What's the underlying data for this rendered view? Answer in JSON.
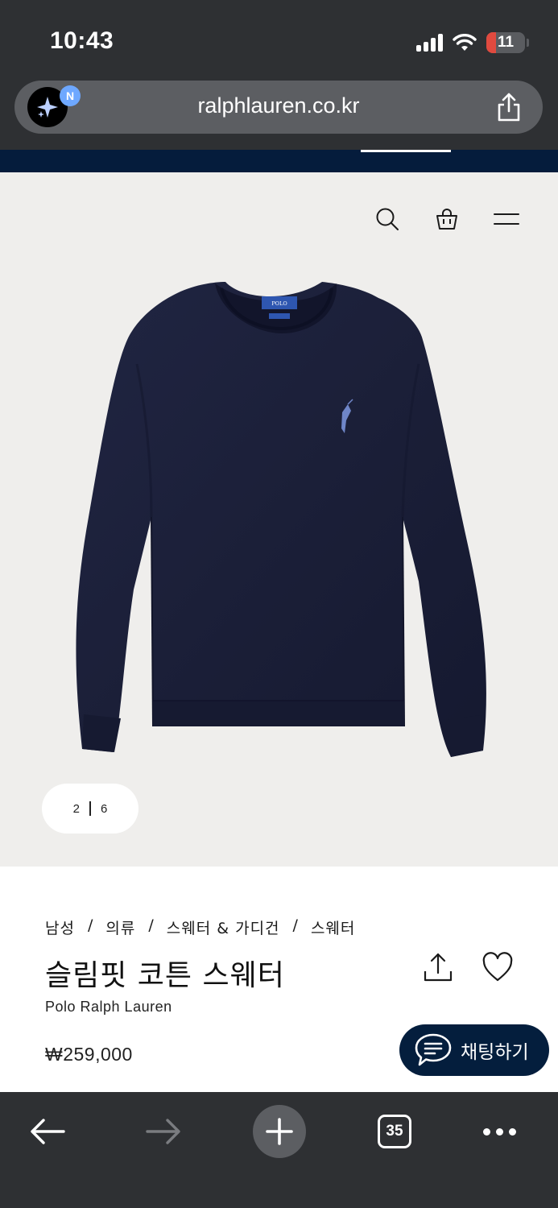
{
  "status_bar": {
    "time": "10:43",
    "battery": "11"
  },
  "browser": {
    "url": "ralphlauren.co.kr",
    "badge": "N",
    "tab_count": "35"
  },
  "gallery": {
    "current_page": "2",
    "total_pages": "6"
  },
  "product": {
    "breadcrumb": [
      "남성",
      "의류",
      "스웨터 & 가디건",
      "스웨터"
    ],
    "title": "슬림핏 코튼 스웨터",
    "brand": "Polo Ralph Lauren",
    "price": "₩259,000"
  },
  "chat": {
    "label": "채팅하기"
  },
  "colors": {
    "navy": "#041e3d",
    "hero_bg": "#efeeec",
    "sweater": "#1c2039",
    "pony": "#6f86c8"
  },
  "icons": [
    "search-icon",
    "shopping-bag-icon",
    "menu-icon",
    "share-icon",
    "heart-icon",
    "chat-icon",
    "back-icon",
    "forward-icon",
    "plus-icon",
    "more-icon"
  ]
}
